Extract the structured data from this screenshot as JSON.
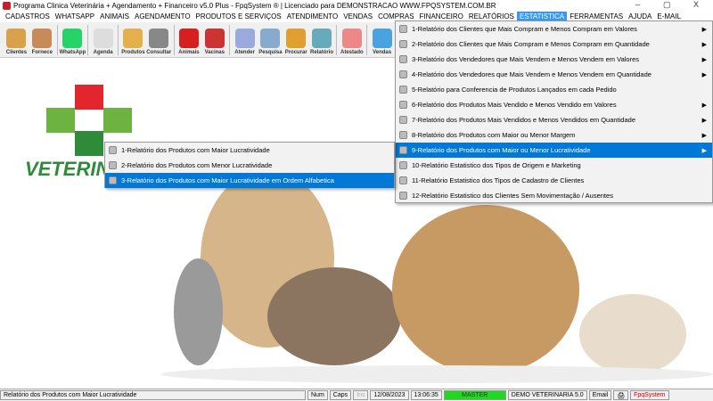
{
  "window": {
    "title": "Programa Clinica Veterinária + Agendamento + Financeiro v5.0 Plus - FpqSystem ® | Licenciado para  DEMONSTRACAO WWW.FPQSYSTEM.COM.BR",
    "minimize": "–",
    "maximize": "▢",
    "close": "X"
  },
  "menubar": [
    "CADASTROS",
    "WHATSAPP",
    "ANIMAIS",
    "AGENDAMENTO",
    "PRODUTOS E SERVIÇOS",
    "ATENDIMENTO",
    "VENDAS",
    "COMPRAS",
    "FINANCEIRO",
    "RELATÓRIOS",
    "ESTATISTICA",
    "FERRAMENTAS",
    "AJUDA",
    "E-MAIL"
  ],
  "toolbar": [
    {
      "label": "Clientes",
      "color": "#d9a24a"
    },
    {
      "label": "Fornece",
      "color": "#c98a5a"
    },
    {
      "label": "WhatsApp",
      "color": "#25d366"
    },
    {
      "label": "Agenda",
      "color": "#ddd"
    },
    {
      "label": "Produtos",
      "color": "#e3b04b"
    },
    {
      "label": "Consultar",
      "color": "#888"
    },
    {
      "label": "Animais",
      "color": "#d62020"
    },
    {
      "label": "Vacinas",
      "color": "#c33"
    },
    {
      "label": "Atender",
      "color": "#9ad"
    },
    {
      "label": "Pesquisa",
      "color": "#8ac"
    },
    {
      "label": "Procurar",
      "color": "#e0a030"
    },
    {
      "label": "Relatório",
      "color": "#6ab"
    },
    {
      "label": "Atestado",
      "color": "#e88"
    },
    {
      "label": "Vendas",
      "color": "#4aa3df"
    }
  ],
  "estatistica_menu": [
    "1-Relatório dos Clientes que Mais Compram e Menos Compram em Valores",
    "2-Relatório dos Clientes que Mais Compram e Menos Compram em Quantidade",
    "3-Relatório dos Vendedores que Mais Vendem e Menos Vendem em Valores",
    "4-Relatório dos Vendedores que Mais Vendem e Menos Vendem em Quantidade",
    "5-Relatório para Conferencia de Produtos Lançados em cada Pedido",
    "6-Relatório dos Produtos Mais Vendido e Menos Vendido em Valores",
    "7-Relatório dos Produtos Mais Vendidos e Menos Vendidos em Quantidade",
    "8-Relatório dos Produtos com Maior ou Menor Margem",
    "9-Relatório dos Produtos com Maior ou Menor Lucratividade",
    "10-Relatório Estatistico dos Tipos de Origem e Marketing",
    "11-Relatório Estatistico dos Tipos de Cadastro de Clientes",
    "12-Relatório Estatistico dos Clientes Sem Movimentação / Ausentes"
  ],
  "submenu": [
    "1-Relatório dos Produtos com Maior Lucratividade",
    "2-Relatório dos Produtos com Menor Lucratividade",
    "3-Relatório dos Produtos com Maior Lucratividade em Ordem Alfabetica"
  ],
  "logo_text": "VETERINÁRIA",
  "status": {
    "message": "Relatório dos Produtos com Maior Lucratividade",
    "num": "Num",
    "caps": "Caps",
    "ins": "Ins",
    "date": "12/08/2023",
    "time": "13:06:35",
    "user": "MASTER",
    "company": "DEMO VETERINARIA 5.0",
    "email": "Email",
    "brand": "FpqSystem"
  }
}
